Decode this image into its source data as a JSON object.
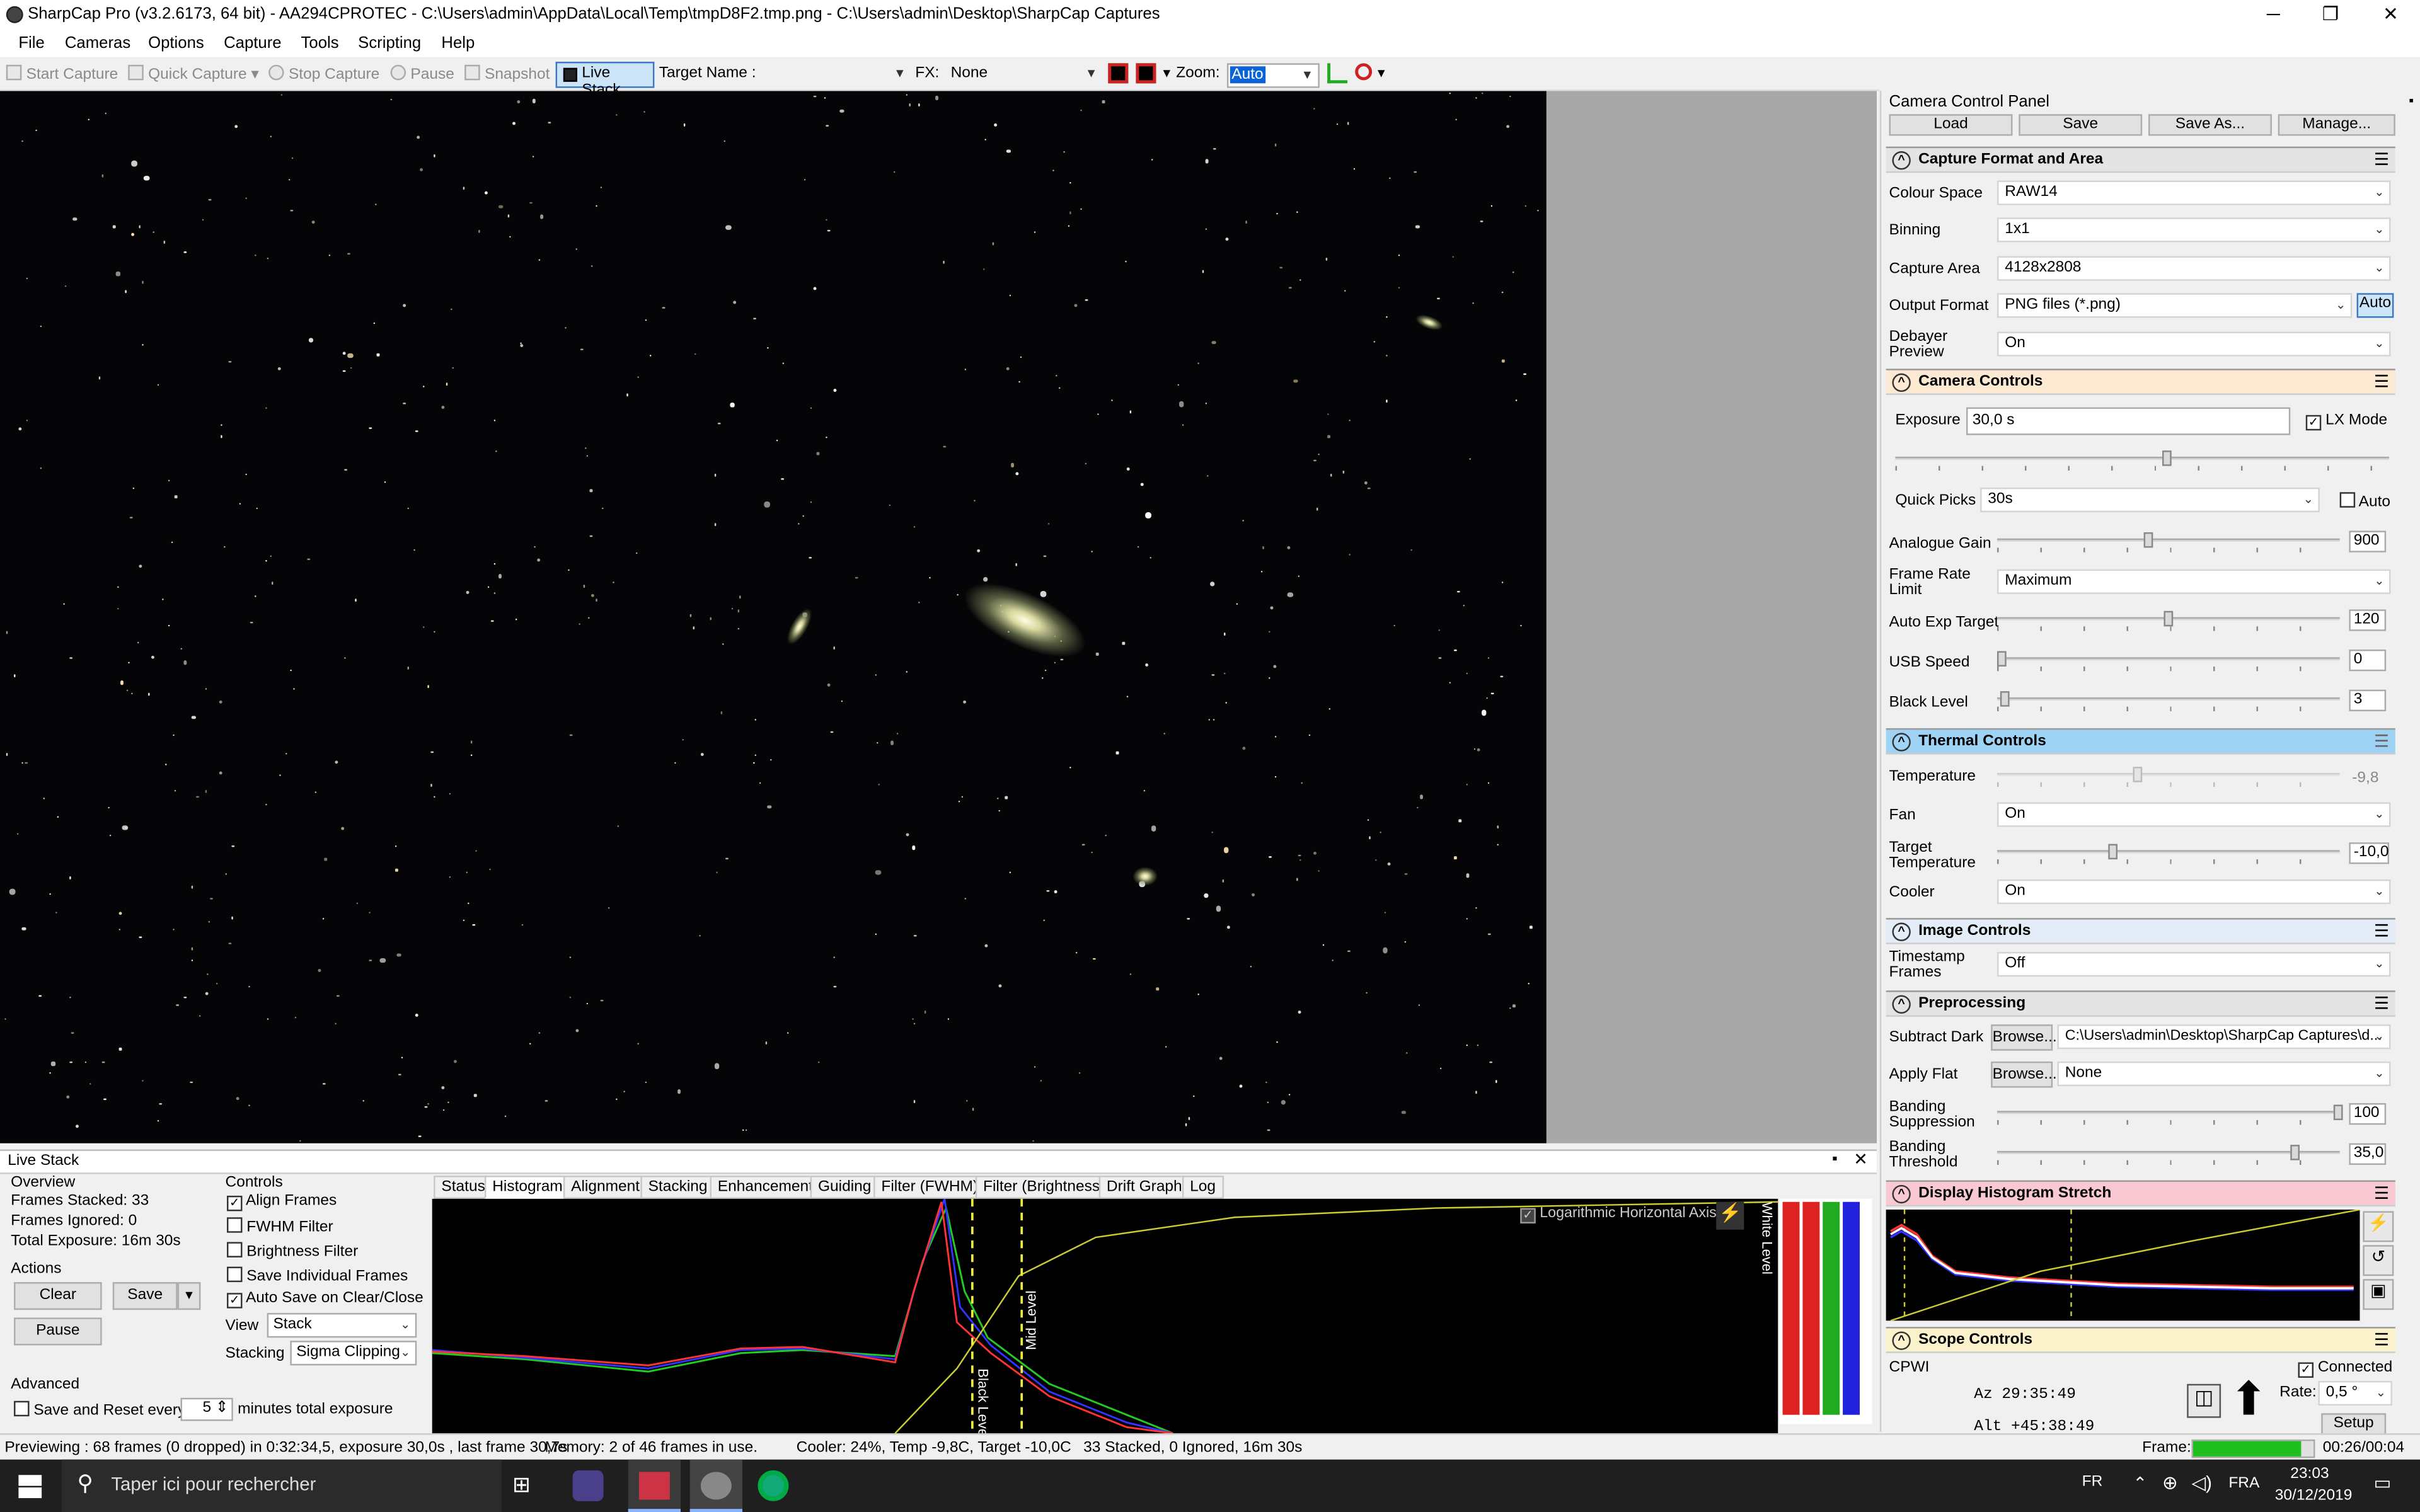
{
  "window": {
    "title": "SharpCap Pro (v3.2.6173, 64 bit) - AA294CPROTEC - C:\\Users\\admin\\AppData\\Local\\Temp\\tmpD8F2.tmp.png - C:\\Users\\admin\\Desktop\\SharpCap Captures",
    "minimize": "─",
    "maximize": "❐",
    "close": "✕"
  },
  "menu": [
    "File",
    "Cameras",
    "Options",
    "Capture",
    "Tools",
    "Scripting",
    "Help"
  ],
  "toolbar": {
    "start": "Start Capture",
    "quick": "Quick Capture",
    "stop": "Stop Capture",
    "pause": "Pause",
    "snapshot": "Snapshot",
    "live": "Live Stack",
    "target_label": "Target Name :",
    "target_value": "",
    "fx_label": "FX:",
    "fx_value": "None",
    "zoom_label": "Zoom:",
    "zoom_value": "Auto"
  },
  "panel": {
    "title": "Camera Control Panel",
    "pin": "📌",
    "load": "Load",
    "save": "Save",
    "saveas": "Save As...",
    "manage": "Manage...",
    "capture": {
      "title": "Capture Format and Area",
      "colour_label": "Colour Space",
      "colour": "RAW14",
      "binning_label": "Binning",
      "binning": "1x1",
      "area_label": "Capture Area",
      "area": "4128x2808",
      "output_label": "Output Format",
      "output": "PNG files (*.png)",
      "auto": "Auto",
      "debayer_label": "Debayer Preview",
      "debayer": "On"
    },
    "camera": {
      "title": "Camera Controls",
      "exposure_label": "Exposure",
      "exposure": "30,0 s",
      "lx": "LX Mode",
      "quick_label": "Quick Picks",
      "quick": "30s",
      "auto": "Auto",
      "gain_label": "Analogue Gain",
      "gain": "900",
      "gain_level": 0.44,
      "frl_label": "Frame Rate Limit",
      "frl": "Maximum",
      "aet_label": "Auto Exp Target",
      "aet": "120",
      "aet_level": 0.5,
      "usb_label": "USB Speed",
      "usb": "0",
      "usb_level": 0,
      "black_label": "Black Level",
      "black": "3",
      "black_level": 0.01,
      "exposure_level": 0.55
    },
    "thermal": {
      "title": "Thermal Controls",
      "temp_label": "Temperature",
      "temp": "-9,8",
      "fan_label": "Fan",
      "fan": "On",
      "target_label": "Target Temperature",
      "target": "-10,0",
      "cooler_label": "Cooler",
      "cooler": "On"
    },
    "image": {
      "title": "Image Controls",
      "ts_label": "Timestamp Frames",
      "ts": "Off"
    },
    "pre": {
      "title": "Preprocessing",
      "dark_label": "Subtract Dark",
      "browse": "Browse...",
      "dark": "C:\\Users\\admin\\Desktop\\SharpCap Captures\\d...",
      "flat_label": "Apply Flat",
      "flat": "None",
      "band_label": "Banding Suppression",
      "band": "100",
      "thr_label": "Banding Threshold",
      "thr": "35,0"
    },
    "hist": {
      "title": "Display Histogram Stretch"
    },
    "scope": {
      "title": "Scope Controls",
      "name": "CPWI",
      "connected": "Connected",
      "az": "Az  29:35:49",
      "alt": "Alt +45:38:49",
      "rate_label": "Rate:",
      "rate": "0,5 °",
      "setup": "Setup"
    }
  },
  "livestack": {
    "title": "Live Stack",
    "overview": "Overview",
    "frames_stacked": "Frames Stacked: 33",
    "frames_ignored": "Frames Ignored:  0",
    "total_exposure": "Total Exposure:   16m 30s",
    "actions": "Actions",
    "clear": "Clear",
    "save": "Save",
    "pause": "Pause",
    "advanced": "Advanced",
    "save_reset": "Save and Reset every",
    "minutes": "5",
    "minutes_label": "minutes total exposure",
    "controls": "Controls",
    "align": "Align Frames",
    "fwhm": "FWHM Filter",
    "brightness": "Brightness Filter",
    "save_ind": "Save Individual Frames",
    "autosave": "Auto Save on Clear/Close",
    "view_label": "View",
    "view": "Stack",
    "stacking_label": "Stacking",
    "stacking": "Sigma Clipping",
    "tabs": [
      "Status",
      "Histogram",
      "Alignment",
      "Stacking",
      "Enhancement",
      "Guiding",
      "Filter (FWHM)",
      "Filter (Brightness)",
      "Drift Graph",
      "Log"
    ],
    "log_axis": "Logarithmic Horizontal Axis",
    "mid": "Mid Level",
    "black": "Black Level",
    "white": "White Level"
  },
  "status": {
    "preview": "Previewing : 68 frames (0 dropped) in 0:32:34,5, exposure 30,0s , last frame 30,7s",
    "memory": "Memory: 2 of 46 frames in use.",
    "cooler": "Cooler: 24%, Temp -9,8C, Target -10,0C",
    "stacked": "33 Stacked, 0 Ignored, 16m 30s",
    "frame_label": "Frame:",
    "time": "00:26/00:04",
    "frame_level": 0.9
  },
  "taskbar": {
    "search": "Taper ici pour rechercher",
    "lang": "FR",
    "kb": "FRA",
    "clock": "23:03",
    "date": "30/12/2019"
  }
}
